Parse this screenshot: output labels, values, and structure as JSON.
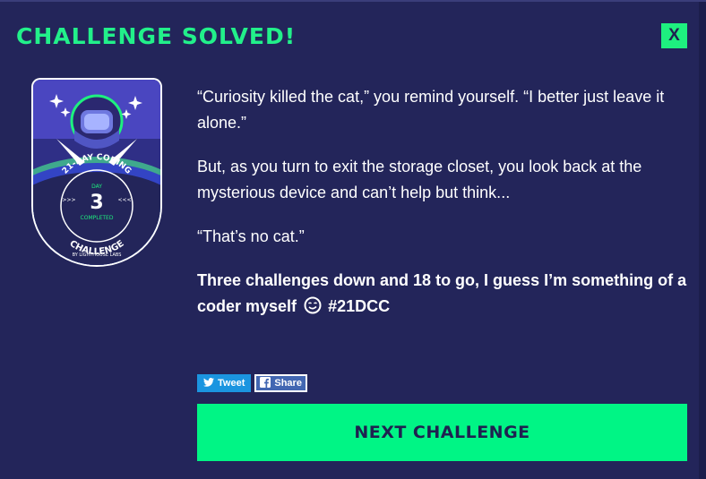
{
  "modal": {
    "title": "CHALLENGE SOLVED!",
    "close_label": "X"
  },
  "badge": {
    "top_text": "21-DAY CODING",
    "day_label": "DAY",
    "day_number": "3",
    "completed_label": "COMPLETED",
    "bottom_text": "CHALLENGE",
    "byline": "BY LIGHTHOUSE LABS",
    "left_chevrons": ">>>",
    "right_chevrons": "<<<"
  },
  "story": {
    "p1": "“Curiosity killed the cat,” you remind yourself. “I better just leave it alone.”",
    "p2": "But, as you turn to exit the storage closet, you look back at the mysterious device and can’t help but think...",
    "p3": "“That’s no cat.”",
    "p4_text": "Three challenges down and 18 to go, I guess I’m something of a coder myself",
    "p4_hashtag": "#21DCC"
  },
  "share": {
    "tweet_label": "Tweet",
    "facebook_label": "Share",
    "tweet_icon": "twitter-bird-icon",
    "facebook_icon": "facebook-icon"
  },
  "next_button_label": "NEXT CHALLENGE",
  "colors": {
    "background": "#23255a",
    "accent_green": "#00f585",
    "title_green": "#22f08a",
    "text": "#ffffff",
    "tweet_blue": "#1b95e0",
    "facebook_blue": "#4267b2"
  }
}
